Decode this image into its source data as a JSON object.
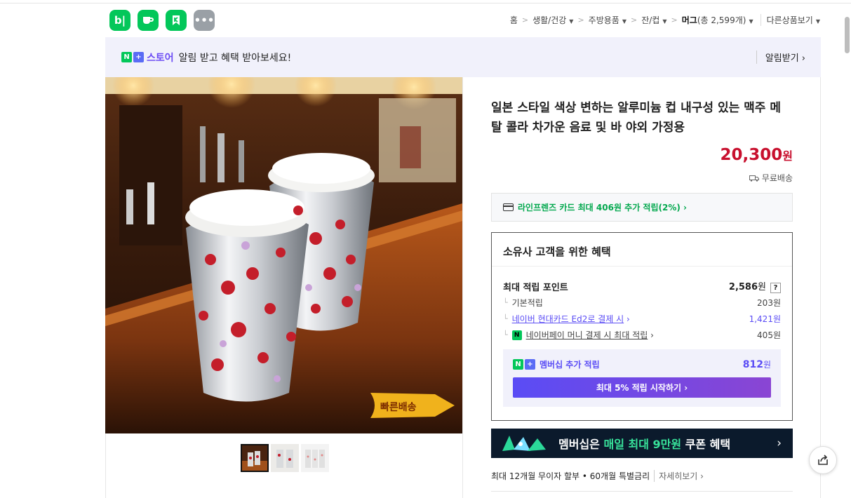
{
  "apps": [
    {
      "label": "b|",
      "icon": "blog-icon",
      "color": "#03c75a"
    },
    {
      "label": "",
      "icon": "cafe-icon",
      "color": "#03c75a"
    },
    {
      "label": "",
      "icon": "bookmark-icon",
      "color": "#03c75a"
    },
    {
      "label": "•••",
      "icon": "more-icon",
      "color": "#9aa0a6"
    }
  ],
  "breadcrumb": {
    "home": "홈",
    "c1": "생활/건강",
    "c2": "주방용품",
    "c3": "잔/컵",
    "c4_name": "머그",
    "c4_count": "(총 2,599개)",
    "other": "다른상품보기"
  },
  "banner": {
    "n_badge": "N",
    "plus_badge": "+",
    "store": "스토어",
    "message": "알림 받고 혜택 받아보세요!",
    "alarm_label": "알림받기"
  },
  "product": {
    "title": "일본 스타일 색상 변하는 알루미늄 컵 내구성 있는 맥주 메탈 콜라 차가운 음료 및 바 야외 가정용",
    "price_value": "20,300",
    "price_unit": "원",
    "shipping": "무료배송",
    "photo_badge": "빠른배송"
  },
  "card_promo": "라인프렌즈 카드 최대 406원 추가 적립(2%)",
  "benefit": {
    "heading": "소유사 고객을 위한 혜택",
    "max_label": "최대 적립 포인트",
    "max_value": "2,586",
    "max_unit": "원",
    "help": "?",
    "rows": [
      {
        "label": "기본적립",
        "value": "203원"
      },
      {
        "label": "네이버 현대카드 Ed2로 결제 시",
        "value": "1,421원"
      },
      {
        "label": "네이버페이 머니 결제 시 최대 적립",
        "value": "405원"
      }
    ],
    "npay_badge": "N",
    "membership_label": "멤버십 추가 적립",
    "membership_value": "812",
    "membership_unit": "원",
    "cta": "최대 5% 적립 시작하기"
  },
  "membership_banner": {
    "pre": "멤버십은 ",
    "highlight": "매일 최대 9만원",
    "post": " 쿠폰 혜택"
  },
  "installment": {
    "text": "최대 12개월 무이자 할부 • 60개월 특별금리",
    "more": "자세히보기"
  }
}
